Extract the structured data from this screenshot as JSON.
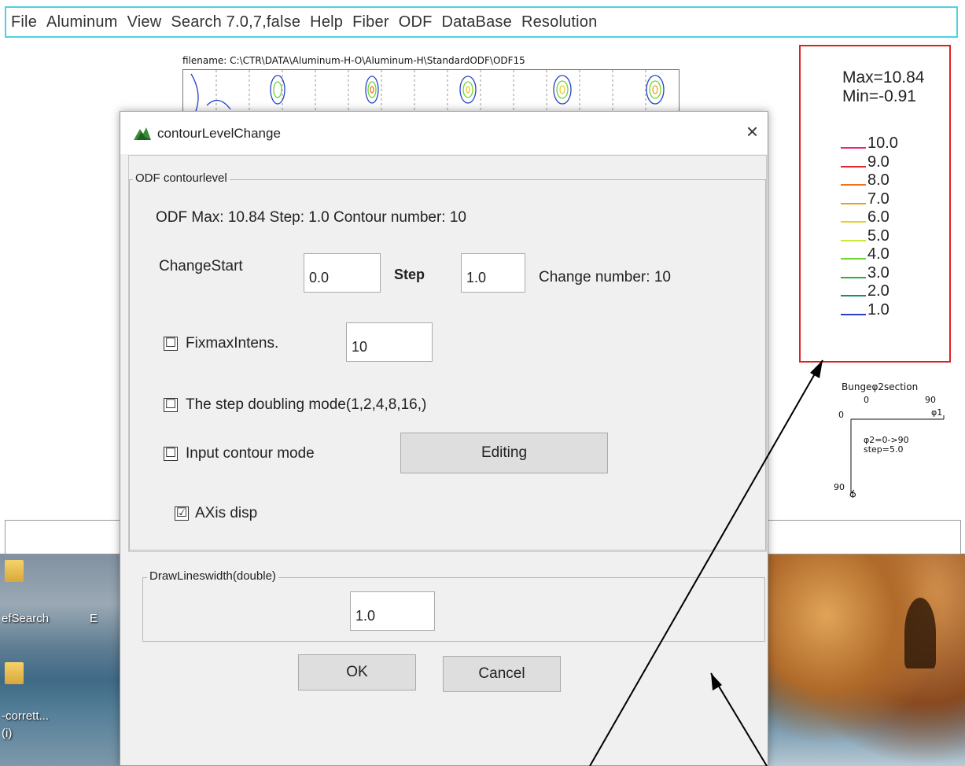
{
  "menubar": {
    "items": [
      "File",
      "Aluminum",
      "View",
      "Search 7.0,7,false",
      "Help",
      "Fiber",
      "ODF",
      "DataBase",
      "Resolution"
    ]
  },
  "plot": {
    "filename": "filename: C:\\CTR\\DATA\\Aluminum-H-O\\Aluminum-H\\StandardODF\\ODF15"
  },
  "legend": {
    "max": "Max=10.84",
    "min": "Min=-0.91",
    "levels": [
      {
        "value": "10.0",
        "color": "#e8287a"
      },
      {
        "value": "9.0",
        "color": "#e8282a"
      },
      {
        "value": "8.0",
        "color": "#f07020"
      },
      {
        "value": "7.0",
        "color": "#f0a020"
      },
      {
        "value": "6.0",
        "color": "#e8d020"
      },
      {
        "value": "5.0",
        "color": "#c8e83a"
      },
      {
        "value": "4.0",
        "color": "#6ad830"
      },
      {
        "value": "3.0",
        "color": "#28b040"
      },
      {
        "value": "2.0",
        "color": "#208a70"
      },
      {
        "value": "1.0",
        "color": "#2840c8"
      }
    ]
  },
  "axis_info": {
    "title": "Bungeφ2section",
    "top_left": "0",
    "top_right": "90",
    "left_top": "0",
    "psi1": "φ1",
    "range": "φ2=0->90",
    "step": "step=5.0",
    "left_bottom": "90",
    "phi": "Φ"
  },
  "desktop": {
    "icon1_label": "efSearch",
    "icon1_extra": "E",
    "icon2_label": "-corrett...",
    "icon2_sub": "(i)"
  },
  "dialog": {
    "title": "contourLevelChange",
    "close": "×",
    "group1_title": "ODF contourlevel",
    "info_line": "ODF Max: 10.84 Step: 1.0 Contour number: 10",
    "change_start_label": "ChangeStart",
    "change_start_value": "0.0",
    "step_label": "Step",
    "step_value": "1.0",
    "change_number": "Change number: 10",
    "fixmax_label": "FixmaxIntens.",
    "fixmax_checked": "☐",
    "fixmax_value": "10",
    "doubling_label": "The step doubling mode(1,2,4,8,16,)",
    "doubling_checked": "☐",
    "input_contour_label": "Input contour mode",
    "input_contour_checked": "☐",
    "editing_button": "Editing",
    "axis_disp_label": "AXis disp",
    "axis_disp_checked": "☑",
    "group2_title": "DrawLineswidth(double)",
    "linewidth_value": "1.0",
    "ok_button": "OK",
    "cancel_button": "Cancel"
  }
}
